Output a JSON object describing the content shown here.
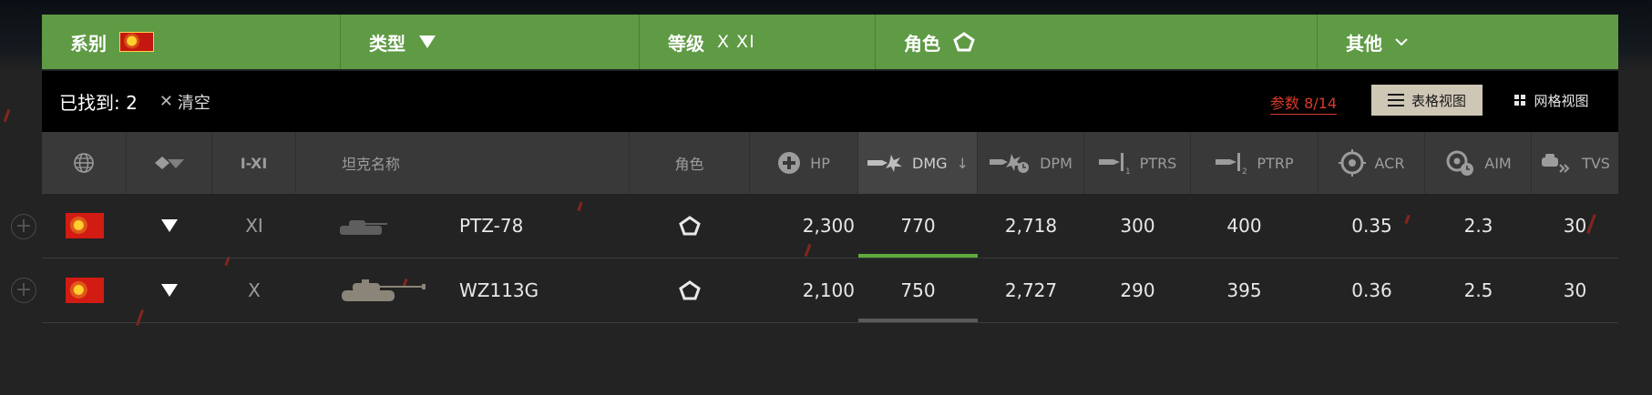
{
  "filters": {
    "nation_label": "系别",
    "type_label": "类型",
    "tier_label": "等级",
    "tier_value": "X XI",
    "role_label": "角色",
    "other_label": "其他"
  },
  "results": {
    "found_label": "已找到: 2",
    "clear_label": "清空",
    "params_label": "参数 8/14",
    "table_view_label": "表格视图",
    "grid_view_label": "网格视图"
  },
  "columns": {
    "tier": "I-XI",
    "name": "坦克名称",
    "role": "角色",
    "hp": "HP",
    "dmg": "DMG",
    "dpm": "DPM",
    "ptrs": "PTRS",
    "ptrp": "PTRP",
    "acr": "ACR",
    "aim": "AIM",
    "tvs": "TVS"
  },
  "sort": {
    "column": "DMG",
    "direction": "descending"
  },
  "colors": {
    "filter_green": "#5f9a45",
    "accent_red": "#d83a2a",
    "bar_green": "#5faa3c",
    "bar_gray": "#5a5a5a"
  },
  "rows": [
    {
      "nation_icon": "china-flag",
      "type_icon": "heavy-tank-icon",
      "tier": "XI",
      "name": "PTZ-78",
      "role_icon": "pentagon-icon",
      "hp": "2,300",
      "dmg": "770",
      "dpm": "2,718",
      "ptrs": "300",
      "ptrp": "400",
      "acr": "0.35",
      "aim": "2.3",
      "tvs": "30"
    },
    {
      "nation_icon": "china-flag",
      "type_icon": "heavy-tank-icon",
      "tier": "X",
      "name": "WZ113G",
      "role_icon": "pentagon-icon",
      "hp": "2,100",
      "dmg": "750",
      "dpm": "2,727",
      "ptrs": "290",
      "ptrp": "395",
      "acr": "0.36",
      "aim": "2.5",
      "tvs": "30"
    }
  ]
}
